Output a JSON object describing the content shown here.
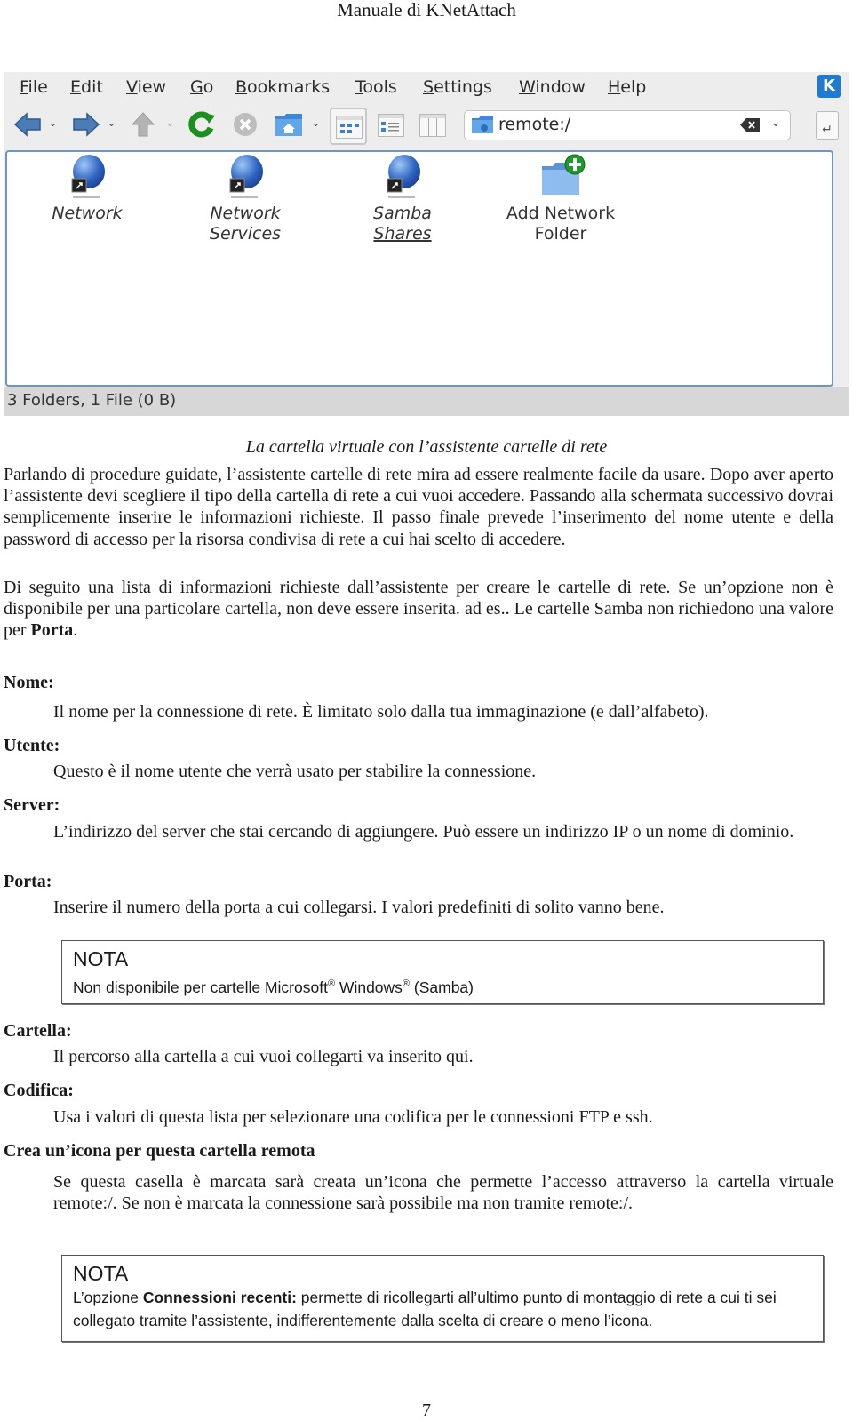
{
  "page": {
    "header": "Manuale di KNetAttach",
    "page_number": "7"
  },
  "window": {
    "menu": [
      {
        "label": "File",
        "accel": "F",
        "rest": "ile"
      },
      {
        "label": "Edit",
        "accel": "E",
        "rest": "dit"
      },
      {
        "label": "View",
        "accel": "V",
        "rest": "iew"
      },
      {
        "label": "Go",
        "accel": "G",
        "rest": "o"
      },
      {
        "label": "Bookmarks",
        "accel": "B",
        "rest": "ookmarks"
      },
      {
        "label": "Tools",
        "accel": "T",
        "rest": "ools"
      },
      {
        "label": "Settings",
        "accel": "S",
        "rest": "ettings"
      },
      {
        "label": "Window",
        "accel": "W",
        "rest": "indow"
      },
      {
        "label": "Help",
        "accel": "H",
        "rest": "elp"
      }
    ],
    "toolbar": {
      "icons": [
        "back-arrow-icon",
        "forward-arrow-icon",
        "up-arrow-icon",
        "reload-icon",
        "stop-icon",
        "home-folder-icon",
        "icon-view-icon",
        "details-view-icon",
        "columns-view-icon"
      ]
    },
    "location": {
      "value": "remote:/"
    },
    "items": [
      {
        "label_line1": "Network",
        "label_line2": "",
        "icon": "network-globe-icon",
        "italic": true
      },
      {
        "label_line1": "Network",
        "label_line2": "Services",
        "icon": "network-globe-icon",
        "italic": true
      },
      {
        "label_line1": "Samba",
        "label_line2": "Shares",
        "icon": "network-globe-icon",
        "italic": true
      },
      {
        "label_line1": "Add Network",
        "label_line2": "Folder",
        "icon": "add-folder-icon",
        "italic": false
      }
    ],
    "status": "3 Folders, 1 File (0 B)"
  },
  "caption": "La cartella virtuale con l’assistente cartelle di rete",
  "paragraphs": {
    "p1": "Parlando di procedure guidate, l’assistente cartelle di rete mira ad essere realmente facile da usare. Dopo aver aperto l’assistente devi scegliere il tipo della cartella di rete a cui vuoi accedere. Passando alla schermata successivo dovrai semplicemente inserire le informazioni richieste. Il passo finale prevede l’inserimento del nome utente e della password di accesso per la risorsa condivisa di rete a cui hai scelto di accedere.",
    "p2_pre": "Di seguito una lista di informazioni richieste dall’assistente per creare le cartelle di rete. Se un’opzione non è disponibile per una particolare cartella, non deve essere inserita. ad es.. Le cartelle Samba non richiedono una valore per ",
    "p2_bold": "Porta",
    "p2_post": "."
  },
  "definitions": {
    "nome": {
      "term": "Nome:",
      "desc": "Il nome per la connessione di rete. È limitato solo dalla tua immaginazione (e dall’alfabeto)."
    },
    "utente": {
      "term": "Utente:",
      "desc": "Questo è il nome utente che verrà usato per stabilire la connessione."
    },
    "server": {
      "term": "Server:",
      "desc": "L’indirizzo del server che stai cercando di aggiungere. Può essere un indirizzo IP o un nome di dominio."
    },
    "porta": {
      "term": "Porta:",
      "desc": "Inserire il numero della porta a cui collegarsi. I valori predefiniti di solito vanno bene."
    },
    "cartella": {
      "term": "Cartella:",
      "desc": "Il percorso alla cartella a cui vuoi collegarti va inserito qui."
    },
    "codifica": {
      "term": "Codifica:",
      "desc": "Usa i valori di questa lista per selezionare una codifica per le connessioni FTP e ssh."
    },
    "icona": {
      "term": "Crea un’icona per questa cartella remota",
      "desc": "Se questa casella è marcata sarà creata un’icona che permette l’accesso attraverso la cartella virtuale remote:/.  Se non è marcata la connessione sarà possibile ma non tramite remote:/."
    }
  },
  "notes": {
    "note1": {
      "title": "NOTA",
      "text_a": "Non disponibile per cartelle Microsoft",
      "reg": "®",
      "text_b": " Windows",
      "text_c": " (Samba)"
    },
    "note2": {
      "title": "NOTA",
      "pre": "L’opzione ",
      "bold": "Connessioni recenti:",
      "post": " permette di ricollegarti all’ultimo punto di montaggio di rete a cui ti sei collegato tramite l’assistente, indifferentemente dalla scelta di creare o meno l’icona."
    }
  }
}
